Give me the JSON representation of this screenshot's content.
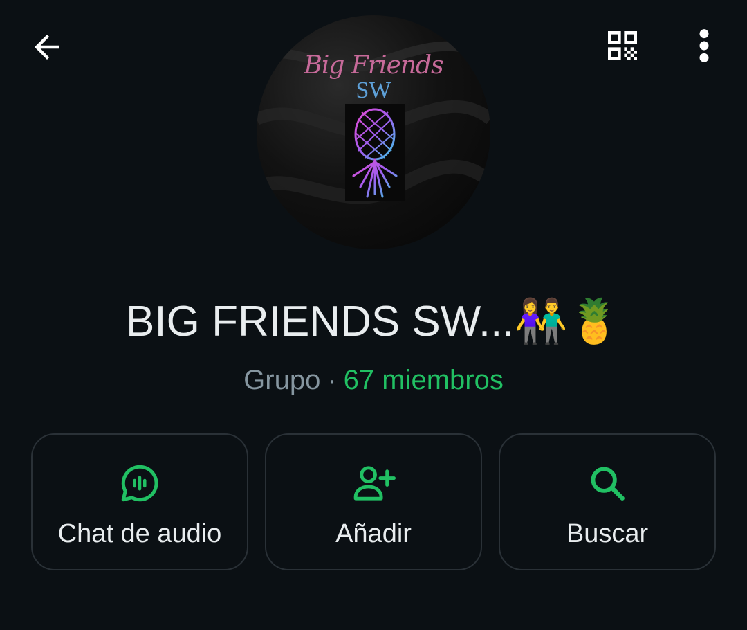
{
  "header": {
    "back_icon": "arrow-left-icon",
    "qr_icon": "qr-code-icon",
    "menu_icon": "more-vertical-icon"
  },
  "avatar": {
    "logo_line1": "Big Friends",
    "logo_line2": "SW"
  },
  "group": {
    "name": "BIG FRIENDS SW...👫🍍",
    "type": "Grupo",
    "separator": "·",
    "members": "67 miembros"
  },
  "actions": [
    {
      "label": "Chat de audio",
      "icon": "audio-chat-icon"
    },
    {
      "label": "Añadir",
      "icon": "add-person-icon"
    },
    {
      "label": "Buscar",
      "icon": "search-icon"
    }
  ],
  "colors": {
    "background": "#0b1014",
    "accent": "#21c063",
    "text_primary": "#e9edef",
    "text_secondary": "#8696a0",
    "card_border": "#2a3137"
  }
}
